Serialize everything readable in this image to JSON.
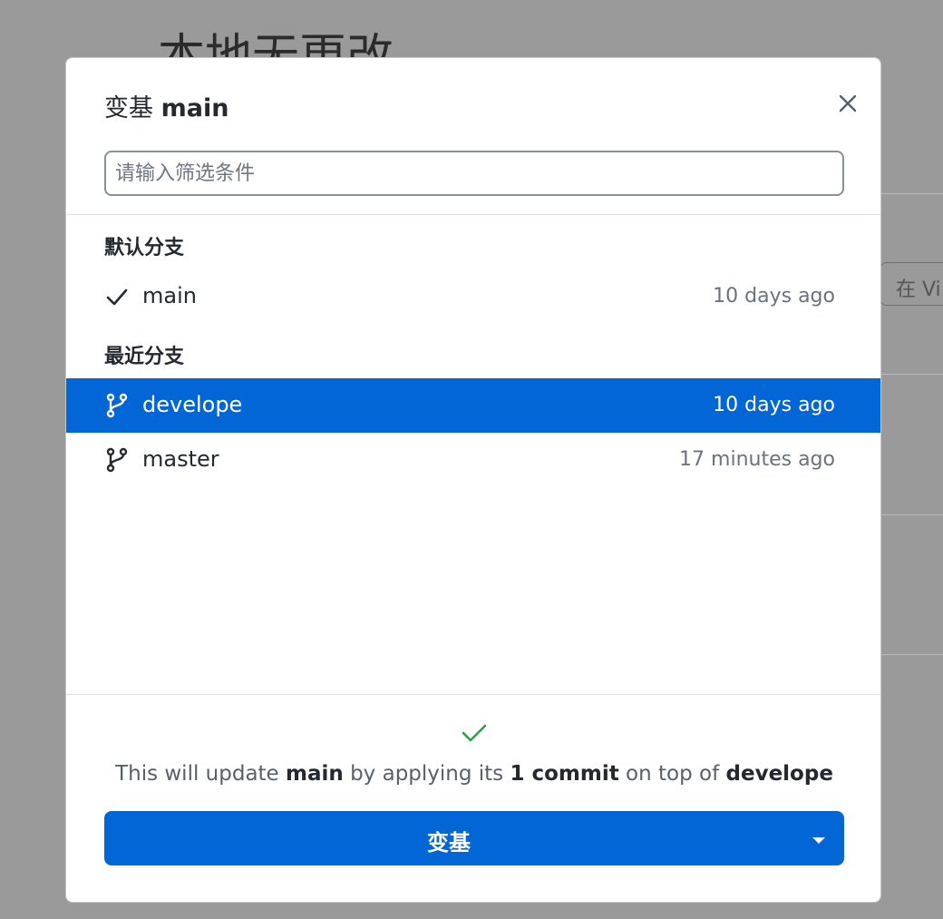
{
  "background": {
    "title": "本地无更改",
    "chip_label": "在 Vi"
  },
  "dialog": {
    "title_prefix": "变基",
    "title_branch": "main",
    "close_icon": "close-icon",
    "filter_placeholder": "请输入筛选条件",
    "filter_value": ""
  },
  "groups": {
    "default": {
      "label": "默认分支",
      "items": [
        {
          "name": "main",
          "time": "10 days ago",
          "icon": "check-icon"
        }
      ]
    },
    "recent": {
      "label": "最近分支",
      "items": [
        {
          "name": "develope",
          "time": "10 days ago",
          "icon": "git-branch-icon",
          "selected": true
        },
        {
          "name": "master",
          "time": "17 minutes ago",
          "icon": "git-branch-icon",
          "selected": false
        }
      ]
    }
  },
  "footer": {
    "status_icon": "check-icon",
    "message": {
      "part1": "This will update ",
      "target": "main",
      "part2": " by applying its ",
      "commits": "1 commit",
      "part3": " on top of ",
      "base": "develope"
    },
    "button_label": "变基",
    "dropdown_icon": "caret-down-icon"
  },
  "colors": {
    "accent": "#0366d6",
    "success": "#2ea043",
    "overlay": "#9a9a9a"
  }
}
